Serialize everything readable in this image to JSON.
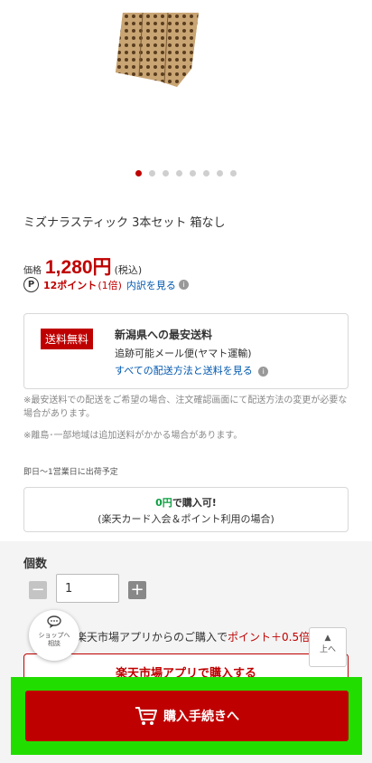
{
  "product": {
    "carousel": {
      "total": 8,
      "active_index": 0
    },
    "title": "ミズナラスティック 3本セット 箱なし",
    "price_label": "価格",
    "price_value": "1,280円",
    "price_tax": "(税込)",
    "points_icon": "P",
    "points_value": "12ポイント",
    "points_multiplier": "(1倍)",
    "points_link": "内訳を見る"
  },
  "shipping": {
    "badge": "送料無料",
    "title": "新潟県への最安送料",
    "method": "追跡可能メール便(ヤマト運輸)",
    "link": "すべての配送方法と送料を見る",
    "note1": "※最安送料での配送をご希望の場合、注文確認画面にて配送方法の変更が必要な場合があります。",
    "note2": "※離島･一部地域は追加送料がかかる場合があります。",
    "timing": "即日〜1営業日に出荷予定"
  },
  "zero_yen": {
    "highlight": "0円",
    "line1_rest": "で購入可!",
    "line2": "(楽天カード入会＆ポイント利用の場合)"
  },
  "quantity": {
    "label": "個数",
    "minus": "−",
    "value": "1",
    "plus": "+"
  },
  "app_promo": {
    "text": "楽天市場アプリからのご購入で",
    "highlight": "ポイント＋0.5倍！",
    "button": "楽天市場アプリで購入する"
  },
  "shop_bubble": {
    "label_line1": "ショップへ",
    "label_line2": "相談"
  },
  "to_top": {
    "arrow": "▲",
    "label": "上へ"
  },
  "purchase": {
    "label": "購入手続きへ"
  },
  "colors": {
    "brand_red": "#bf0000",
    "link_blue": "#0058b0",
    "green_highlight": "#0a9e3f",
    "focus_frame": "#22dd00"
  }
}
